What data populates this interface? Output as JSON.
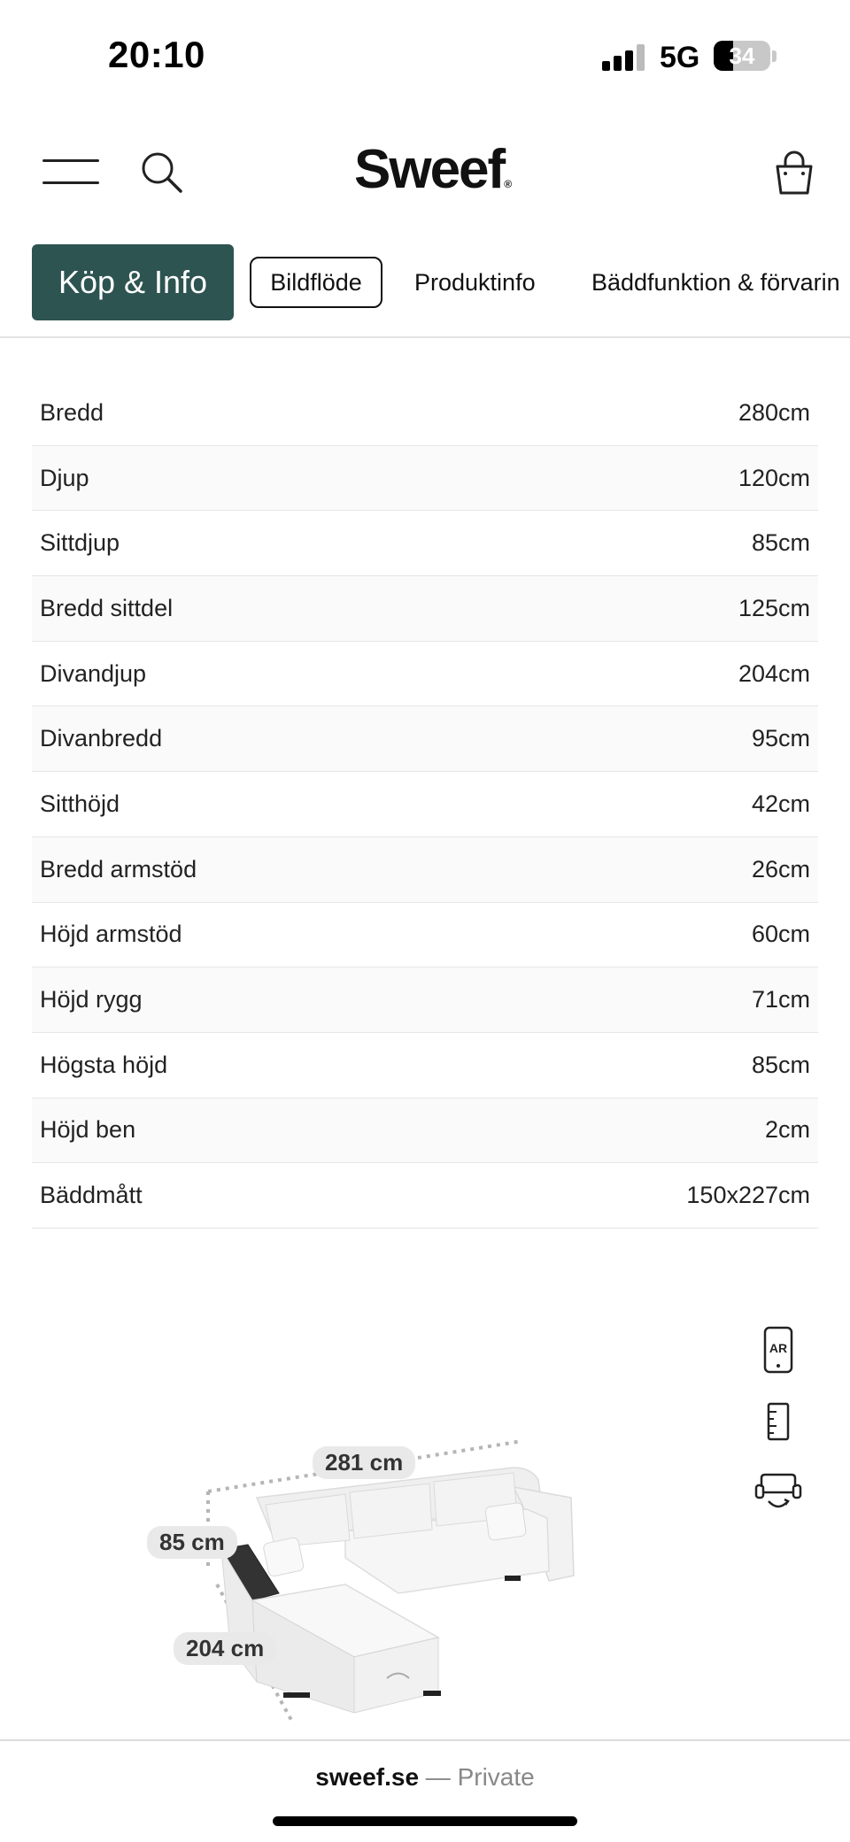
{
  "status_bar": {
    "time": "20:10",
    "network": "5G",
    "battery_level": "34",
    "battery_fraction": 0.34
  },
  "header": {
    "logo": "Sweef",
    "logo_mark": "®",
    "icons": [
      "menu-icon",
      "search-icon",
      "shopping-bag-icon"
    ]
  },
  "tabs": [
    {
      "label": "Köp & Info",
      "state": "active"
    },
    {
      "label": "Bildflöde",
      "state": "outlined"
    },
    {
      "label": "Produktinfo",
      "state": "default"
    },
    {
      "label": "Bäddfunktion & förvarin",
      "state": "default"
    }
  ],
  "specs": [
    {
      "label": "Bredd",
      "value": "280cm"
    },
    {
      "label": "Djup",
      "value": "120cm"
    },
    {
      "label": "Sittdjup",
      "value": "85cm"
    },
    {
      "label": "Bredd sittdel",
      "value": "125cm"
    },
    {
      "label": "Divandjup",
      "value": "204cm"
    },
    {
      "label": "Divanbredd",
      "value": "95cm"
    },
    {
      "label": "Sitthöjd",
      "value": "42cm"
    },
    {
      "label": "Bredd armstöd",
      "value": "26cm"
    },
    {
      "label": "Höjd armstöd",
      "value": "60cm"
    },
    {
      "label": "Höjd rygg",
      "value": "71cm"
    },
    {
      "label": "Högsta höjd",
      "value": "85cm"
    },
    {
      "label": "Höjd ben",
      "value": "2cm"
    },
    {
      "label": "Bäddmått",
      "value": "150x227cm"
    }
  ],
  "side_icons": {
    "ar_label": "AR",
    "names": [
      "ar-view-icon",
      "ruler-icon",
      "sofa-bed-icon"
    ]
  },
  "illustration": {
    "dim_width": "281 cm",
    "dim_height": "85 cm",
    "dim_depth": "204 cm"
  },
  "footer": {
    "site": "sweef.se",
    "separator": "—",
    "mode": "Private"
  },
  "colors": {
    "accent": "#2d5451",
    "text": "#1a1a1a",
    "divider": "#e6e6e6"
  }
}
